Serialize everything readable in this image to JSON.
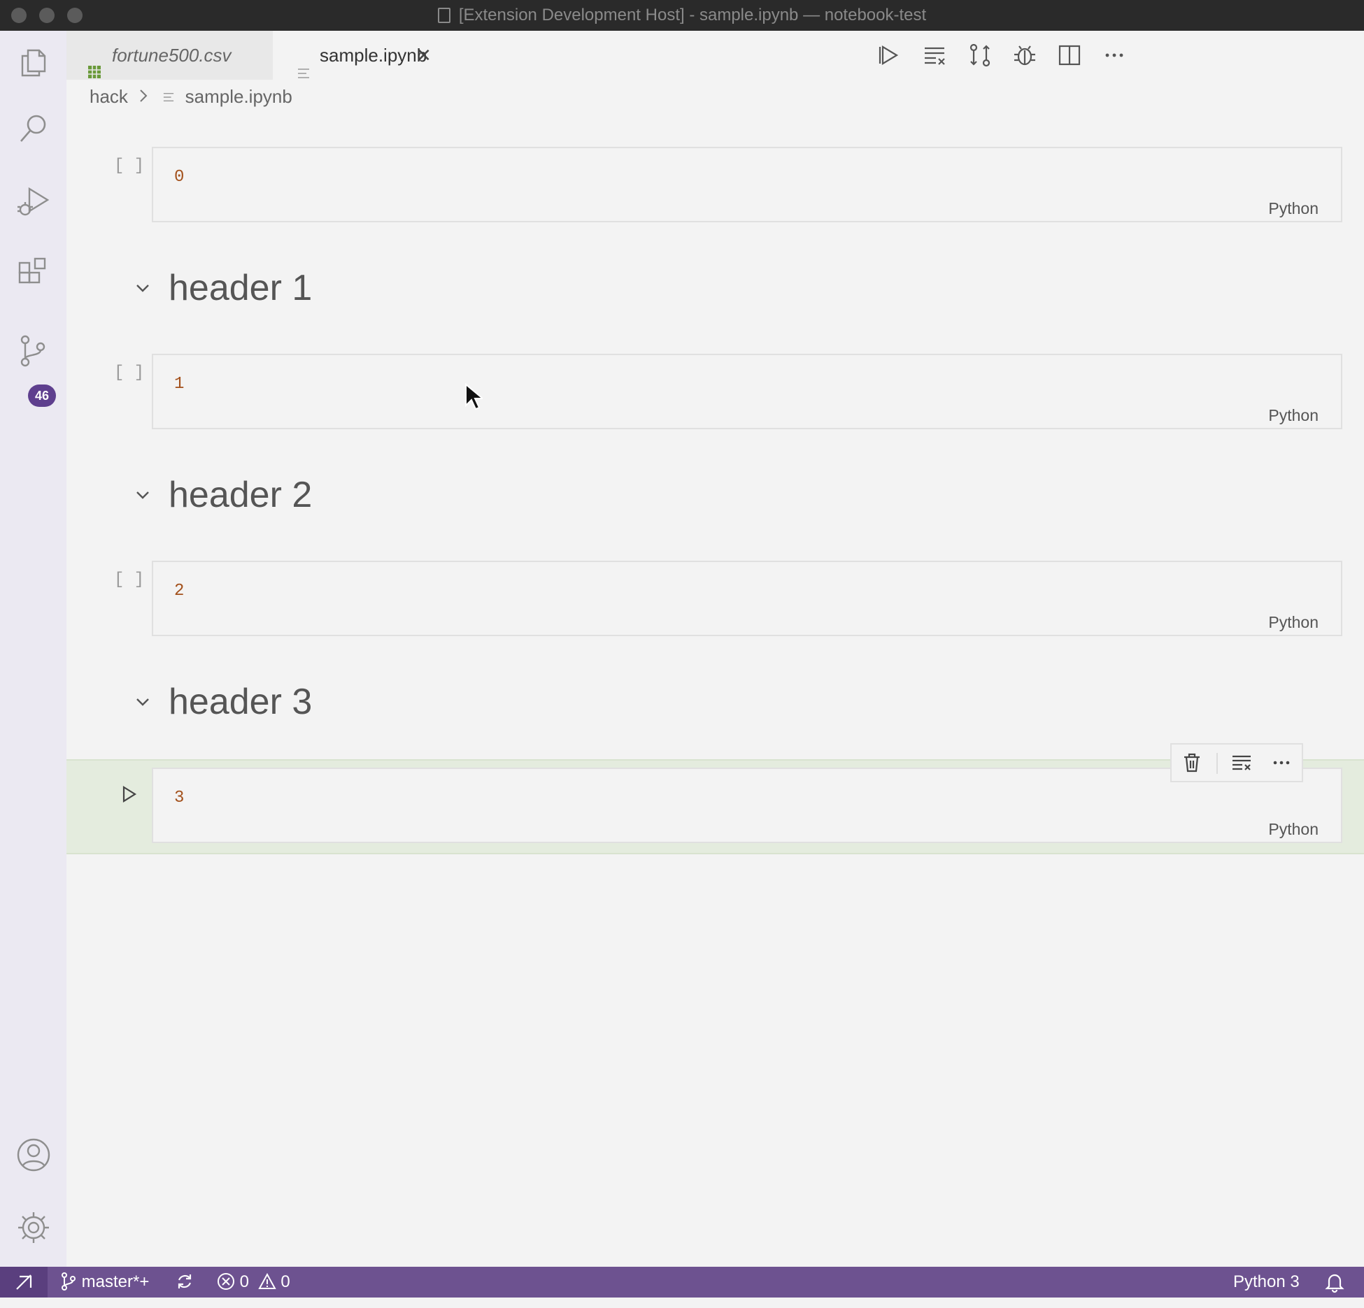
{
  "window": {
    "title": "[Extension Development Host] - sample.ipynb — notebook-test"
  },
  "activity_bar": {
    "icons": [
      "explorer-icon",
      "search-icon",
      "run-debug-icon",
      "extensions-icon",
      "source-control-icon",
      "account-icon",
      "settings-gear-icon"
    ],
    "source_control_badge": "46"
  },
  "tabs": [
    {
      "label": "fortune500.csv",
      "icon": "spreadsheet-icon",
      "active": false,
      "italic": true
    },
    {
      "label": "sample.ipynb",
      "icon": "notebook-icon",
      "active": true,
      "close_glyph": "✕"
    }
  ],
  "editor_actions": [
    "run-all-icon",
    "clear-outputs-icon",
    "compare-changes-icon",
    "debug-icon",
    "split-editor-icon",
    "more-actions-icon"
  ],
  "breadcrumb": {
    "folder": "hack",
    "file": "sample.ipynb"
  },
  "cells": [
    {
      "type": "code",
      "exec": "[ ]",
      "source": "0",
      "language": "Python"
    },
    {
      "type": "markdown",
      "text": "header 1"
    },
    {
      "type": "code",
      "exec": "[ ]",
      "source": "1",
      "language": "Python"
    },
    {
      "type": "markdown",
      "text": "header 2"
    },
    {
      "type": "code",
      "exec": "[ ]",
      "source": "2",
      "language": "Python"
    },
    {
      "type": "markdown",
      "text": "header 3"
    },
    {
      "type": "code",
      "exec": "run",
      "source": "3",
      "language": "Python",
      "focused": true
    }
  ],
  "cell_toolbar": [
    "delete-icon",
    "clear-output-icon",
    "more-icon"
  ],
  "status_bar": {
    "branch": "master*+",
    "errors": "0",
    "warnings": "0",
    "kernel": "Python 3"
  },
  "colors": {
    "status_bar": "#6d5290",
    "badge": "#5e3f8e",
    "code_number": "#a3511c",
    "focused_cell": "#e4ecde"
  }
}
